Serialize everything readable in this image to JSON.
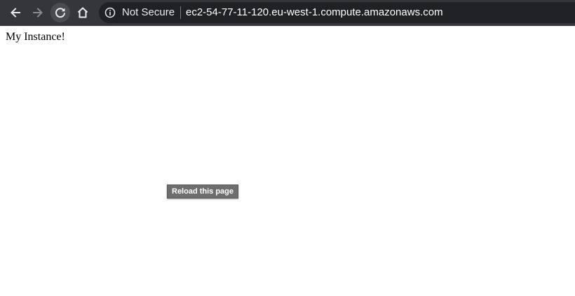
{
  "toolbar": {
    "back_icon": "arrow-left-icon",
    "forward_icon": "arrow-right-icon",
    "reload_icon": "reload-icon",
    "home_icon": "home-icon",
    "background_color": "#35363a"
  },
  "omnibox": {
    "info_icon": "info-circle-icon",
    "security_label": "Not Secure",
    "url": "ec2-54-77-11-120.eu-west-1.compute.amazonaws.com",
    "background_color": "#202124"
  },
  "page": {
    "body_text": "My Instance!"
  },
  "tooltip": {
    "text": "Reload this page"
  }
}
